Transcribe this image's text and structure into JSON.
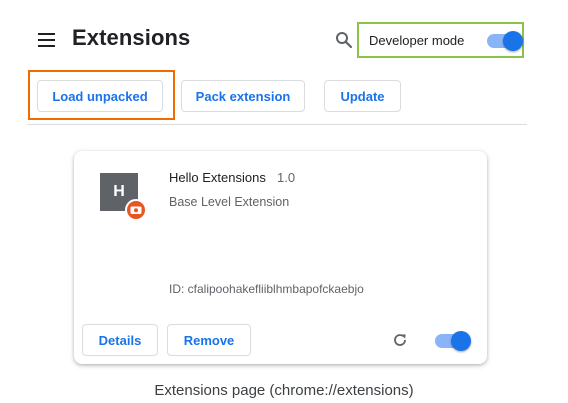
{
  "header": {
    "menu_icon": "menu-icon",
    "title": "Extensions",
    "search_icon": "search-icon",
    "developer_mode": {
      "label": "Developer mode",
      "enabled": true
    }
  },
  "toolbar": {
    "load_unpacked": "Load unpacked",
    "pack_extension": "Pack extension",
    "update": "Update"
  },
  "extension": {
    "icon_letter": "H",
    "name": "Hello Extensions",
    "version": "1.0",
    "description": "Base Level Extension",
    "id_text": "ID: cfalipoohakefliiblhmbapofckaebjo",
    "details_label": "Details",
    "remove_label": "Remove",
    "reload_icon": "reload-icon",
    "enabled": true
  },
  "caption": "Extensions page (chrome://extensions)",
  "colors": {
    "accent": "#1a73e8",
    "toggle_track": "#8ab4f8",
    "highlight_orange": "#f06c00",
    "highlight_green": "#8bc34a",
    "badge": "#e8571f"
  }
}
